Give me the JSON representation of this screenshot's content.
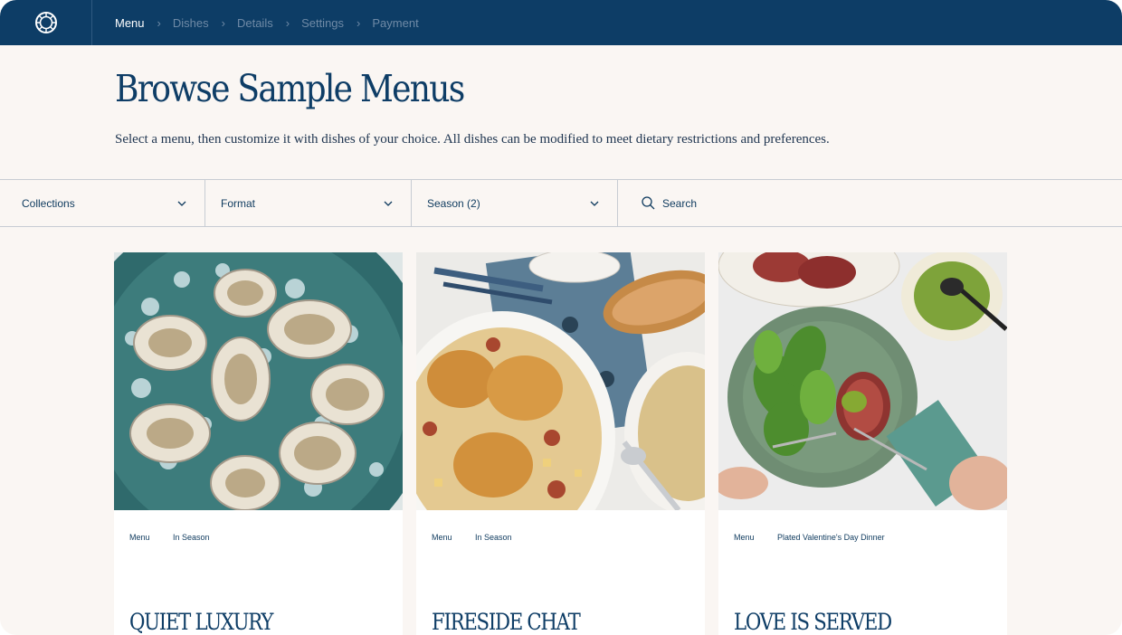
{
  "nav": {
    "logo_icon": "circular-emblem-icon",
    "breadcrumb": [
      "Menu",
      "Dishes",
      "Details",
      "Settings",
      "Payment"
    ],
    "active_index": 0
  },
  "header": {
    "title": "Browse Sample Menus",
    "subtitle": "Select a menu, then customize it with dishes of your choice. All dishes can be modified to meet dietary restrictions and preferences."
  },
  "filters": {
    "collections": "Collections",
    "format": "Format",
    "season": "Season (2)",
    "search": "Search"
  },
  "cards": [
    {
      "tag1": "Menu",
      "tag2": "In Season",
      "name": "QUIET LUXURY",
      "image": "oysters-on-ice"
    },
    {
      "tag1": "Menu",
      "tag2": "In Season",
      "name": "FIRESIDE CHAT",
      "image": "roasted-chicken-with-bread"
    },
    {
      "tag1": "Menu",
      "tag2": "Plated Valentine's Day Dinner",
      "name": "LOVE IS SERVED",
      "image": "steak-and-greens-plate"
    }
  ],
  "colors": {
    "nav_bg": "#0d3d66",
    "page_bg": "#faf6f3",
    "text_primary": "#0e3d66"
  }
}
